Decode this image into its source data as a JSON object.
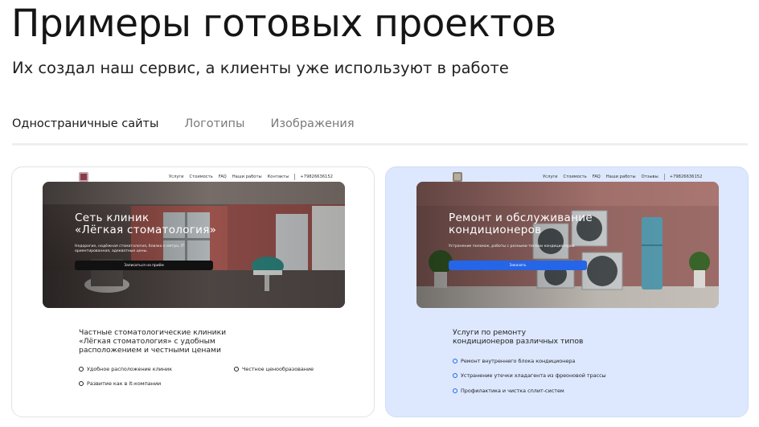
{
  "header": {
    "title": "Примеры готовых проектов",
    "subtitle": "Их создал наш сервис, а клиенты уже используют в работе"
  },
  "tabs": [
    {
      "label": "Одностраничные сайты",
      "active": true
    },
    {
      "label": "Логотипы",
      "active": false
    },
    {
      "label": "Изображения",
      "active": false
    }
  ],
  "cards": [
    {
      "nav": {
        "links": [
          "Услуги",
          "Стоимость",
          "FAQ",
          "Наши работы",
          "Контакты"
        ],
        "phone": "+79826636152"
      },
      "hero": {
        "title_line1": "Сеть клиник",
        "title_line2": "«Лёгкая стоматология»",
        "desc": "Недорогие, надёжная стоматология, близко к метро, IT-ориентированная, адекватные цены.",
        "button": "Записаться на приём",
        "button_color": "#111111"
      },
      "section_title": "Частные стоматологические клиники «Лёгкая стоматология» с удобным расположением и честными ценами",
      "features": [
        "Удобное расположение клиник",
        "Честное ценообразование",
        "Развитие как в it-компании"
      ]
    },
    {
      "nav": {
        "links": [
          "Услуги",
          "Стоимость",
          "FAQ",
          "Наши работы",
          "Отзывы"
        ],
        "phone": "+79826636152"
      },
      "hero": {
        "title_line1": "Ремонт и обслуживание",
        "title_line2": "кондиционеров",
        "desc": "Устранение поломок, работы с разными типами кондиционеров",
        "button": "Заказать",
        "button_color": "#2565e8"
      },
      "section_title": "Услуги по ремонту кондиционеров различных типов",
      "features": [
        "Ремонт внутреннего блока кондиционера",
        "Устранение утечки хладагента из фреоновой трассы",
        "Профилактика и чистка сплит-систем"
      ]
    }
  ],
  "colors": {
    "accent_blue": "#2565e8",
    "card2_bg": "#dde8ff"
  }
}
